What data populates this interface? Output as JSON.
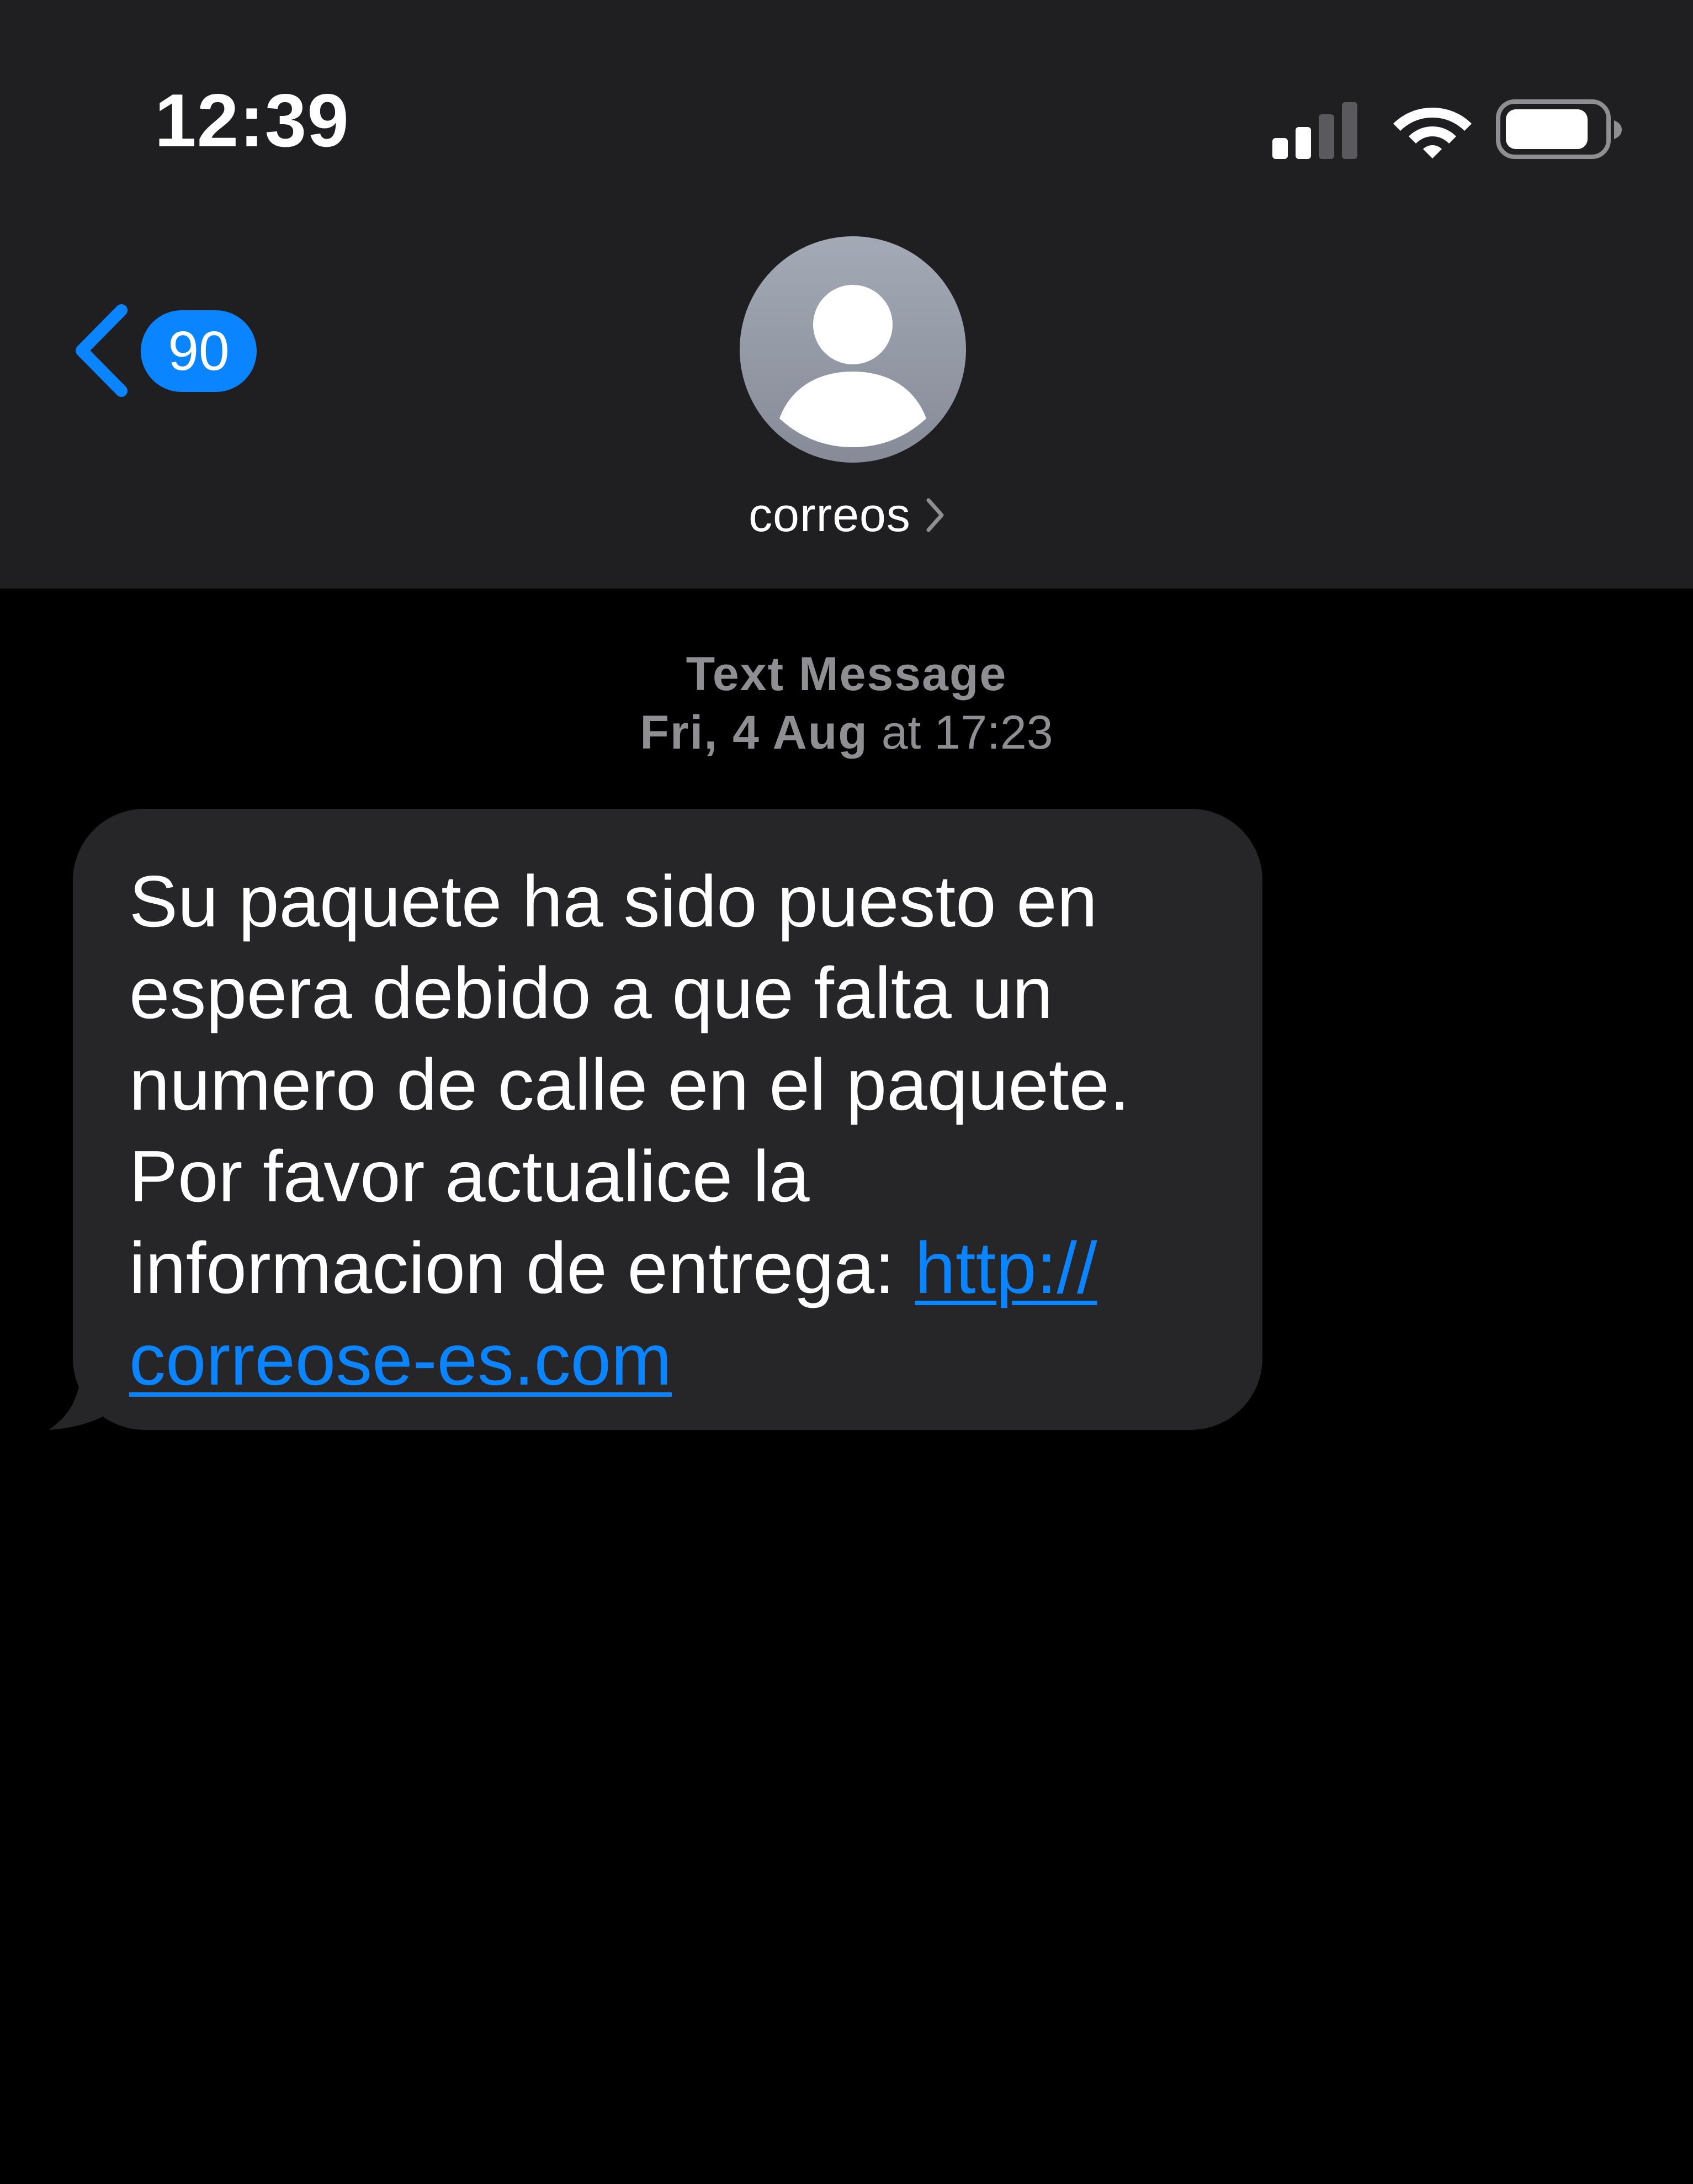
{
  "status_bar": {
    "time": "12:39",
    "icons": [
      "cellular-signal-icon",
      "wifi-icon",
      "battery-icon"
    ]
  },
  "nav": {
    "back_badge_count": "90",
    "back_icon": "chevron-left-icon",
    "avatar_icon": "person-silhouette-icon",
    "contact_name": "correos",
    "contact_chevron_icon": "chevron-right-icon"
  },
  "thread": {
    "service_label": "Text Message",
    "date_day": "Fri, 4 Aug",
    "date_at": "at",
    "date_time": "17:23"
  },
  "message": {
    "lines": [
      "Su paquete ha sido puesto en",
      "espera debido a que falta un",
      "numero de calle en el paquete.",
      "Por favor actualice la"
    ],
    "last_line_prefix": "informacion de entrega: ",
    "link_part_1": "http://",
    "link_part_2": "correose-es.com"
  },
  "colors": {
    "header_background": "#1f1f21",
    "page_background": "#000000",
    "accent_blue": "#0a84ff",
    "incoming_bubble": "#262628",
    "secondary_text": "#8e8e93"
  }
}
